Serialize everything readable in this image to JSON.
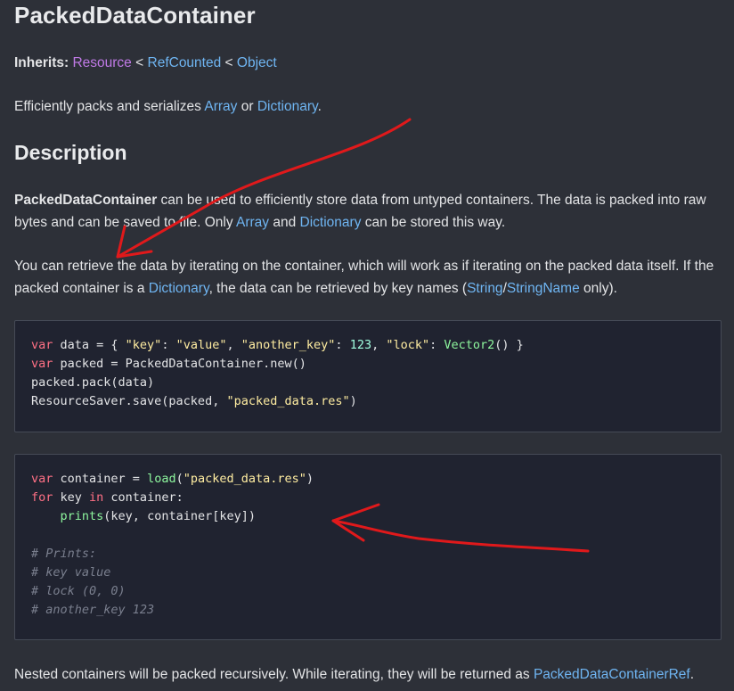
{
  "page": {
    "title": "PackedDataContainer",
    "inherits": {
      "label": "Inherits:",
      "chain": [
        "Resource",
        "RefCounted",
        "Object"
      ],
      "separator": "<"
    },
    "brief": {
      "prefix": "Efficiently packs and serializes ",
      "link1": "Array",
      "middle": " or ",
      "link2": "Dictionary",
      "suffix": "."
    },
    "description_heading": "Description",
    "para1": {
      "bold": "PackedDataContainer",
      "text1": " can be used to efficiently store data from untyped containers. The data is packed into raw bytes and can be saved to file. Only ",
      "link1": "Array",
      "text2": " and ",
      "link2": "Dictionary",
      "text3": " can be stored this way."
    },
    "para2": {
      "text1": "You can retrieve the data by iterating on the container, which will work as if iterating on the packed data itself. If the packed container is a ",
      "link1": "Dictionary",
      "text2": ", the data can be retrieved by key names (",
      "link2": "String",
      "sep": "/",
      "link3": "StringName",
      "text3": " only)."
    },
    "code1": [
      "var data = { \"key\": \"value\", \"another_key\": 123, \"lock\": Vector2() }",
      "var packed = PackedDataContainer.new()",
      "packed.pack(data)",
      "ResourceSaver.save(packed, \"packed_data.res\")"
    ],
    "code2": [
      "var container = load(\"packed_data.res\")",
      "for key in container:",
      "    prints(key, container[key])",
      "",
      "# Prints:",
      "# key value",
      "# lock (0, 0)",
      "# another_key 123"
    ],
    "para3": {
      "text1": "Nested containers will be packed recursively. While iterating, they will be returned as ",
      "link1": "PackedDataContainerRef",
      "text2": "."
    }
  },
  "colors": {
    "background": "#2d3038",
    "link": "#6fb5f2",
    "resource_link": "#c07ae6",
    "keyword": "#ff7085",
    "string": "#ffeda1",
    "number": "#a1ffe0",
    "function": "#8ef79e",
    "comment": "#7a7f8e",
    "annotation": "#e0191b"
  }
}
